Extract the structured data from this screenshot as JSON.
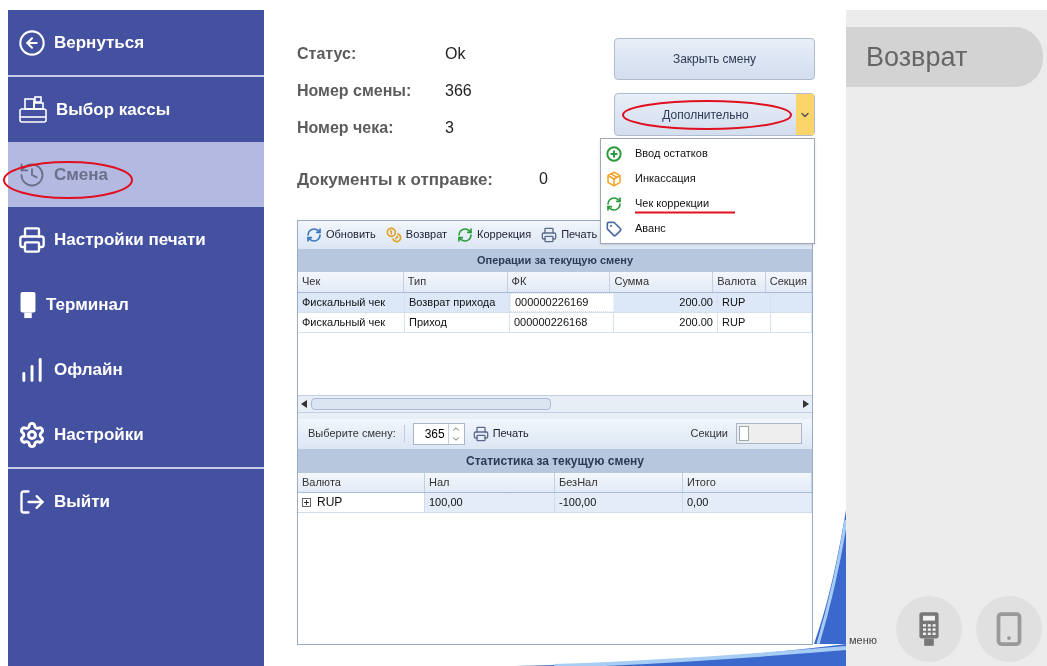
{
  "sidebar": {
    "groups": [
      [
        {
          "label": "Вернуться",
          "kind": "back",
          "selected": false
        }
      ],
      [
        {
          "label": "Выбор кассы",
          "kind": "register",
          "selected": false
        },
        {
          "label": "Смена",
          "kind": "shift",
          "selected": true
        },
        {
          "label": "Настройки печати",
          "kind": "print",
          "selected": false
        },
        {
          "label": "Терминал",
          "kind": "terminal",
          "selected": false
        },
        {
          "label": "Офлайн",
          "kind": "offline",
          "selected": false
        },
        {
          "label": "Настройки",
          "kind": "settings",
          "selected": false
        }
      ],
      [
        {
          "label": "Выйти",
          "kind": "exit",
          "selected": false
        }
      ]
    ]
  },
  "status": [
    {
      "label": "Статус:",
      "value": "Ok"
    },
    {
      "label": "Номер смены:",
      "value": "366"
    },
    {
      "label": "Номер чека:",
      "value": "3"
    }
  ],
  "documents": {
    "label": "Документы к отправке:",
    "value": "0"
  },
  "close_shift_button": "Закрыть смену",
  "more_button": {
    "label": "Дополнительно",
    "expanded": true
  },
  "more_menu": [
    {
      "label": "Ввод остатков",
      "kind": "add"
    },
    {
      "label": "Инкассация",
      "kind": "box"
    },
    {
      "label": "Чек коррекции",
      "kind": "correction"
    },
    {
      "label": "Аванс",
      "kind": "tag"
    }
  ],
  "operations": {
    "toolbar": [
      {
        "label": "Обновить",
        "kind": "refresh"
      },
      {
        "label": "Возврат",
        "kind": "coins"
      },
      {
        "label": "Коррекция",
        "kind": "correction"
      },
      {
        "label": "Печать",
        "kind": "print"
      }
    ],
    "title": "Операции за текущую смену",
    "columns": [
      "Чек",
      "Тип",
      "ФК",
      "Сумма",
      "Валюта",
      "Секция"
    ],
    "rows": [
      {
        "cells": [
          "Фискальный чек",
          "Возврат прихода",
          "000000226169",
          "200.00",
          "RUP",
          ""
        ],
        "selected": true
      },
      {
        "cells": [
          "Фискальный чек",
          "Приход",
          "000000226168",
          "200.00",
          "RUP",
          ""
        ],
        "selected": false
      }
    ]
  },
  "shift_selector": {
    "label": "Выберите смену:",
    "value": "365",
    "print": "Печать",
    "sections": {
      "label": "Секции",
      "on": false
    }
  },
  "statistics": {
    "title": "Статистика за текущую смену",
    "columns": [
      "Валюта",
      "Нал",
      "БезНал",
      "Итого"
    ],
    "rows": [
      {
        "cells": [
          "RUP",
          "100,00",
          "-100,00",
          "0,00"
        ],
        "expanded": false
      }
    ]
  },
  "right_panel": {
    "title": "Возврат",
    "footer": "меню"
  }
}
